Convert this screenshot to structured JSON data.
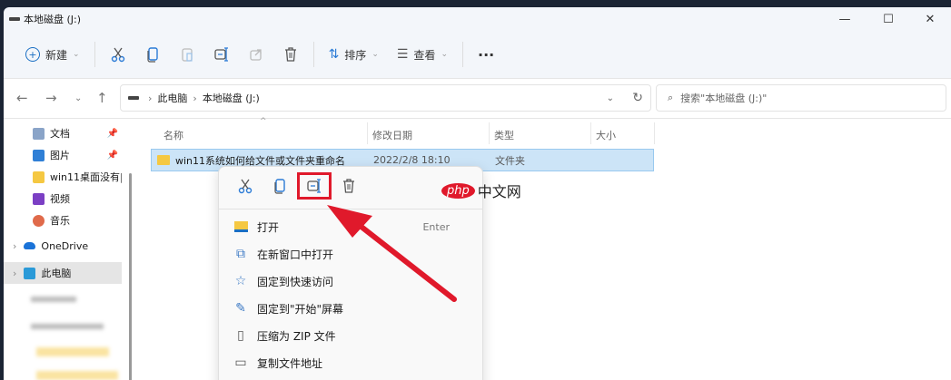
{
  "window": {
    "title": "本地磁盘 (J:)",
    "minimize": "—",
    "maximize": "☐",
    "close": "✕"
  },
  "toolbar": {
    "new_label": "新建",
    "sort_label": "排序",
    "view_label": "查看",
    "more": "···"
  },
  "address": {
    "crumbs": [
      "此电脑",
      "本地磁盘 (J:)"
    ],
    "search_placeholder": "搜索\"本地磁盘 (J:)\""
  },
  "sidebar": {
    "items": [
      {
        "label": "文档",
        "pinned": true
      },
      {
        "label": "图片",
        "pinned": true
      },
      {
        "label": "win11桌面没有‖"
      },
      {
        "label": "视频"
      },
      {
        "label": "音乐"
      },
      {
        "label": "OneDrive"
      },
      {
        "label": "此电脑"
      }
    ]
  },
  "columns": [
    "名称",
    "修改日期",
    "类型",
    "大小"
  ],
  "files": [
    {
      "name": "win11系统如何给文件或文件夹重命名",
      "date": "2022/2/8 18:10",
      "type": "文件夹",
      "size": ""
    }
  ],
  "context_menu": {
    "items": [
      {
        "label": "打开",
        "shortcut": "Enter"
      },
      {
        "label": "在新窗口中打开"
      },
      {
        "label": "固定到快速访问"
      },
      {
        "label": "固定到\"开始\"屏幕"
      },
      {
        "label": "压缩为 ZIP 文件"
      },
      {
        "label": "复制文件地址"
      }
    ]
  },
  "watermark": {
    "php": "php",
    "text": "中文网"
  },
  "colors": {
    "highlight": "#e0192b",
    "selection": "#cce4f7"
  }
}
